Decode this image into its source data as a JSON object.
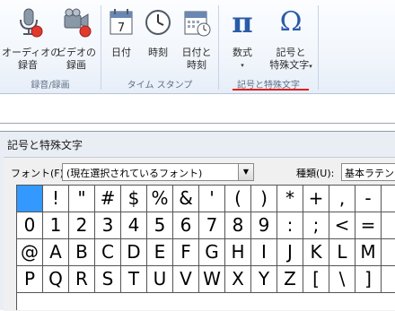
{
  "ribbon": {
    "groups": [
      {
        "label": "録音/録画",
        "buttons": [
          {
            "label_line1": "オーディオの",
            "label_line2": "録音",
            "icon": "microphone-icon"
          },
          {
            "label_line1": "ビデオの",
            "label_line2": "録画",
            "icon": "video-camera-icon"
          }
        ]
      },
      {
        "label": "タイム スタンプ",
        "buttons": [
          {
            "label_line1": "日付",
            "label_line2": "",
            "icon": "calendar-icon",
            "calendar_day": "7"
          },
          {
            "label_line1": "時刻",
            "label_line2": "",
            "icon": "clock-icon"
          },
          {
            "label_line1": "日付と",
            "label_line2": "時刻",
            "icon": "calendar-clock-icon"
          }
        ]
      },
      {
        "label": "記号と特殊文字",
        "buttons": [
          {
            "label_line1": "数式",
            "label_line2": "▾",
            "icon": "pi-icon",
            "glyph": "π"
          },
          {
            "label_line1": "記号と",
            "label_line2": "特殊文字",
            "caret": "▾",
            "icon": "omega-icon",
            "glyph": "Ω"
          }
        ]
      }
    ],
    "highlight_color": "#e02020"
  },
  "dialog": {
    "title": "記号と特殊文字",
    "font_label": "フォント(F):",
    "font_value": "(現在選択されているフォント)",
    "dropdown_arrow": "▼",
    "kind_label": "種類(U):",
    "kind_value": "基本ラテン",
    "selected_color": "#3399ff"
  },
  "grid": {
    "rows": [
      [
        " ",
        "!",
        "\"",
        "#",
        "$",
        "%",
        "&",
        "'",
        "(",
        ")",
        "*",
        "+",
        ",",
        "-"
      ],
      [
        "0",
        "1",
        "2",
        "3",
        "4",
        "5",
        "6",
        "7",
        "8",
        "9",
        ":",
        ";",
        "<",
        "="
      ],
      [
        "@",
        "A",
        "B",
        "C",
        "D",
        "E",
        "F",
        "G",
        "H",
        "I",
        "J",
        "K",
        "L",
        "M"
      ],
      [
        "P",
        "Q",
        "R",
        "S",
        "T",
        "U",
        "V",
        "W",
        "X",
        "Y",
        "Z",
        "[",
        "\\",
        "]"
      ]
    ],
    "selected": [
      0,
      0
    ]
  }
}
